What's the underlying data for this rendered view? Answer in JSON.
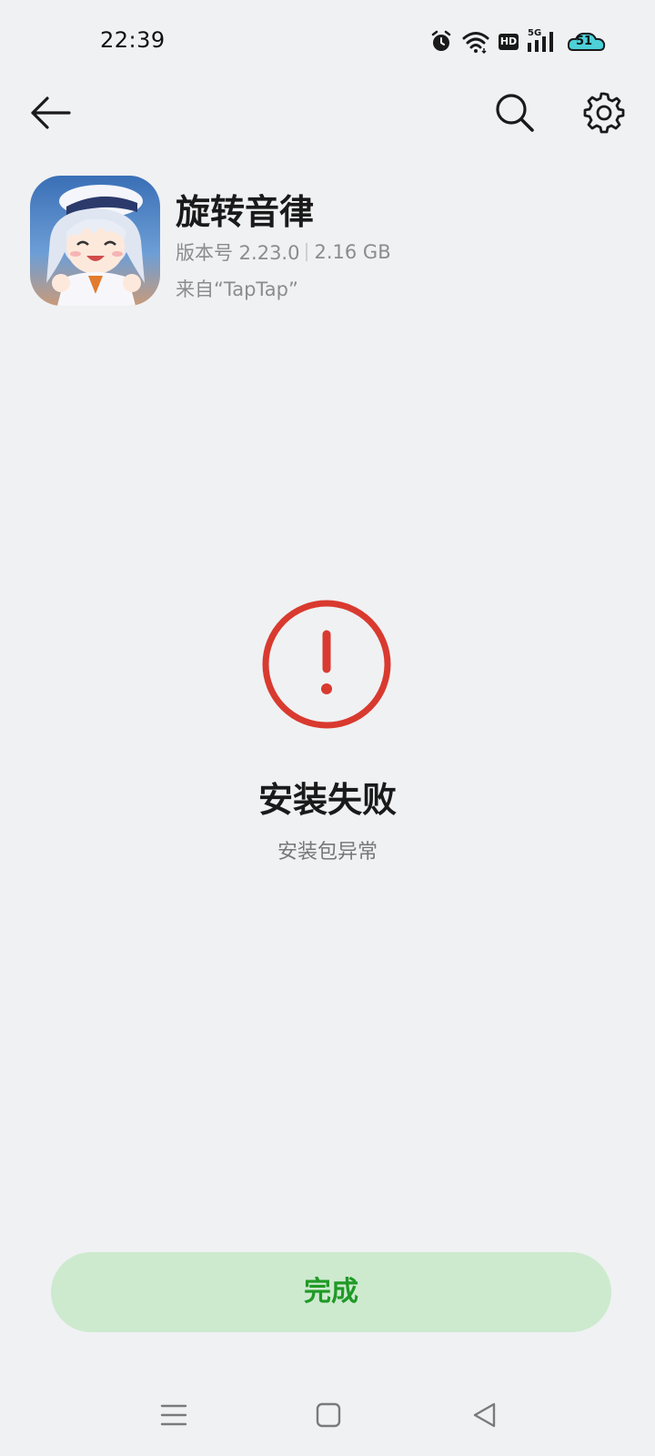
{
  "status_bar": {
    "time": "22:39",
    "hd_label": "HD",
    "network_label": "5G",
    "battery_level": "51",
    "icons": [
      "alarm-icon",
      "wifi-icon",
      "hd-icon",
      "signal-5g-icon",
      "battery-icon"
    ]
  },
  "toolbar": {
    "back_icon": "arrow-left-icon",
    "search_icon": "search-icon",
    "settings_icon": "gear-icon"
  },
  "app": {
    "name": "旋转音律",
    "version": "版本号 2.23.0",
    "size": "2.16 GB",
    "source": "来自“TapTap”"
  },
  "result": {
    "icon": "error-exclamation-icon",
    "title": "安装失败",
    "reason": "安装包异常"
  },
  "done_button": {
    "label": "完成"
  },
  "nav_bar": {
    "menu_icon": "menu-icon",
    "home_icon": "home-square-icon",
    "back_icon": "back-triangle-icon"
  },
  "colors": {
    "background": "#f0f1f3",
    "error_red": "#d93a2f",
    "done_button_bg": "#cdeacf",
    "done_button_text": "#1f9a26"
  }
}
